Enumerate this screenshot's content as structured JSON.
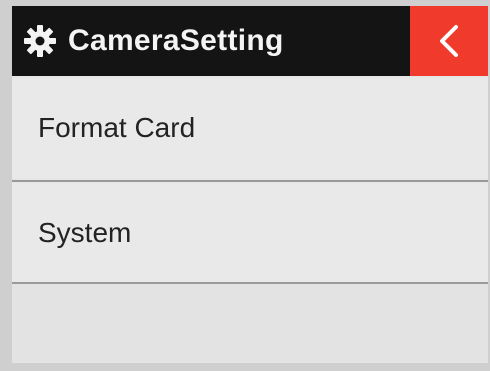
{
  "header": {
    "title": "CameraSetting",
    "icon": "gear-icon",
    "back_icon": "chevron-left-icon"
  },
  "menu": {
    "items": [
      {
        "label": "Format Card"
      },
      {
        "label": "System"
      }
    ]
  },
  "colors": {
    "header_bg": "#141414",
    "back_button_bg": "#ef3a2c",
    "menu_bg": "#e9e9e9",
    "text": "#222222"
  }
}
